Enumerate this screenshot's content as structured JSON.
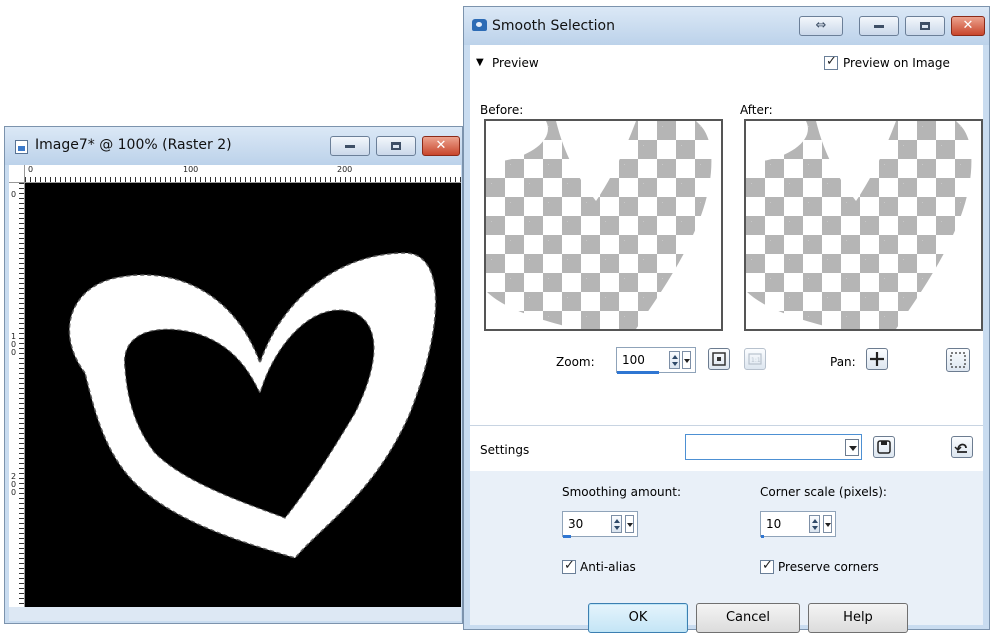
{
  "image_window": {
    "title": "Image7* @ 100% (Raster 2)",
    "ruler_h_labels": [
      "0",
      "100",
      "200"
    ],
    "ruler_v_labels": [
      "0",
      "1\n0\n0",
      "2\n0\n0"
    ],
    "canvas_color": "#000000"
  },
  "dialog": {
    "title": "Smooth Selection",
    "preview_section": "Preview",
    "preview_on_image_label": "Preview on Image",
    "preview_on_image_checked": true,
    "before_label": "Before:",
    "after_label": "After:",
    "zoom_label": "Zoom:",
    "zoom_value": "100",
    "pan_label": "Pan:",
    "settings_label": "Settings",
    "settings_value": "",
    "smoothing_amount_label": "Smoothing amount:",
    "smoothing_amount_value": "30",
    "corner_scale_label": "Corner scale (pixels):",
    "corner_scale_value": "10",
    "anti_alias_label": "Anti-alias",
    "anti_alias_checked": true,
    "preserve_corners_label": "Preserve corners",
    "preserve_corners_checked": true,
    "ok_label": "OK",
    "cancel_label": "Cancel",
    "help_label": "Help"
  },
  "icons": [
    "document-icon",
    "app-icon",
    "minimize-icon",
    "maximize-icon",
    "close-icon",
    "restore-toggle-icon",
    "zoom-fit-icon",
    "zoom-actual-icon",
    "pan-icon",
    "marquee-icon",
    "save-preset-icon",
    "reset-icon",
    "spinner-arrows-icon",
    "dropdown-arrow-icon",
    "checkmark-icon",
    "triangle-collapse-icon"
  ],
  "colors": {
    "window_frame": "#c9dcf0",
    "accent": "#2f76d2",
    "close_red": "#c8462c",
    "checker": "#b5b5b5"
  }
}
